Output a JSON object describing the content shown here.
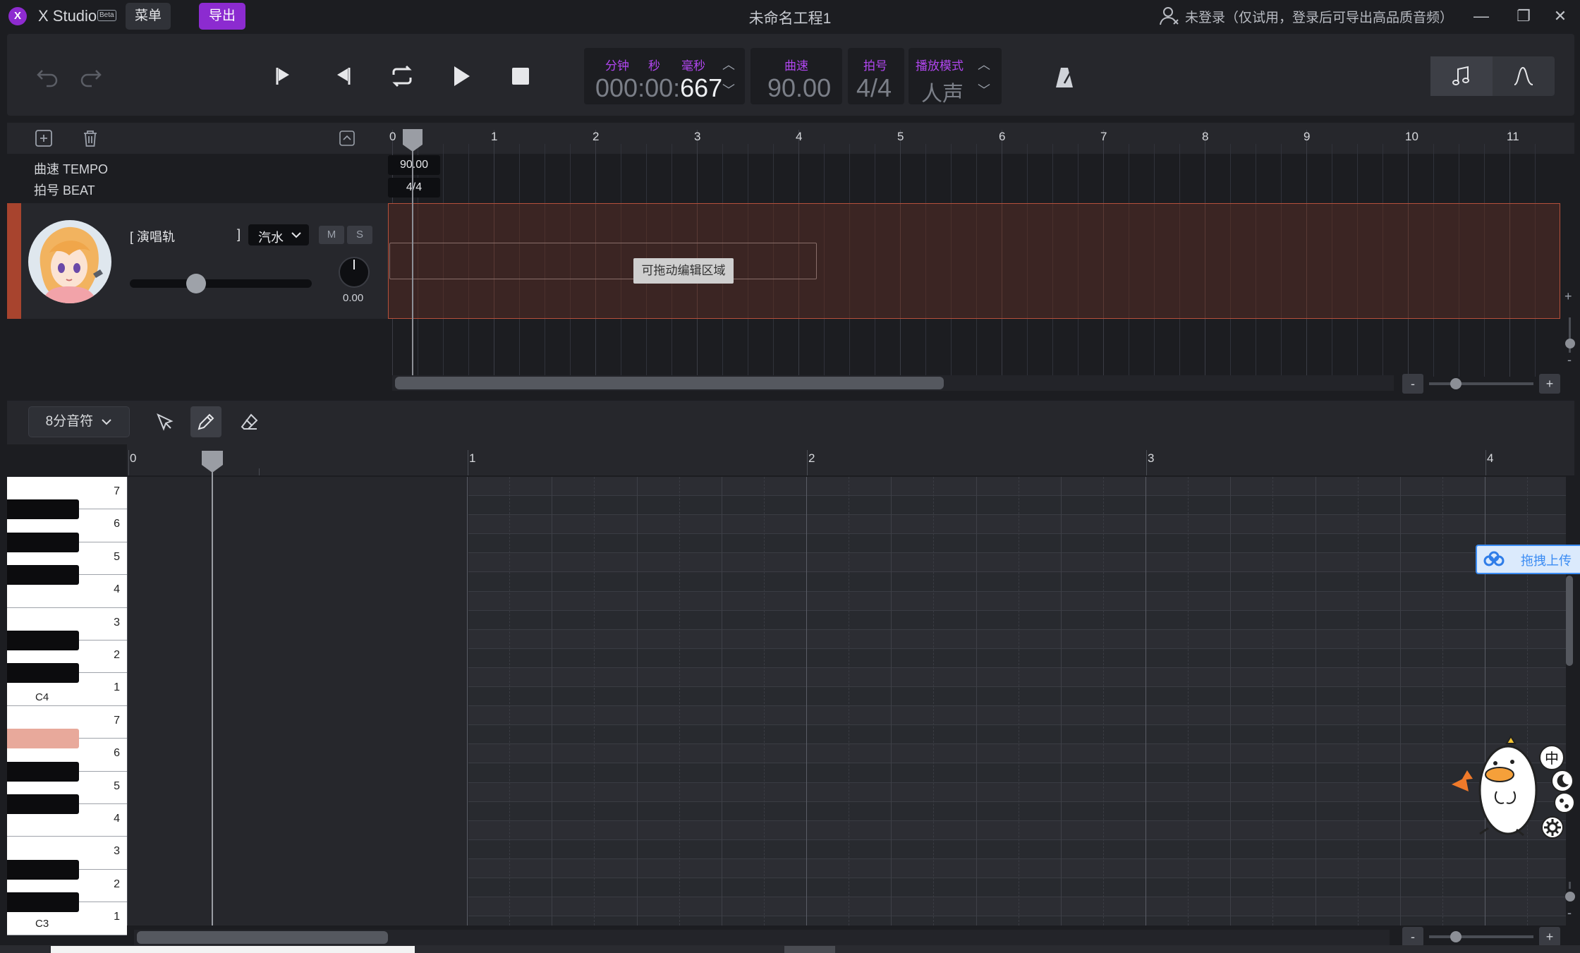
{
  "app": {
    "logo_glyph": "X",
    "name": "X Studio",
    "badge": "Beta",
    "menu_label": "菜单",
    "export_label": "导出",
    "project_title": "未命名工程1",
    "login_status": "未登录（仅试用，登录后可导出高品质音频）",
    "accent_color": "#8c2bd0"
  },
  "window_controls": {
    "minimize": "—",
    "restore": "❐",
    "close": "✕"
  },
  "transport": {
    "time": {
      "label_min": "分钟",
      "label_sec": "秒",
      "label_ms": "毫秒",
      "value_dim": "000:00:",
      "value_bright": "667"
    },
    "tempo": {
      "label": "曲速",
      "value": "90.00"
    },
    "beat": {
      "label": "拍号",
      "value": "4/4"
    },
    "play_mode": {
      "label": "播放模式",
      "value": "人声"
    }
  },
  "tracks": {
    "ruler_numbers": [
      "0",
      "1",
      "2",
      "3",
      "4",
      "5",
      "6",
      "7",
      "8",
      "9",
      "10",
      "11"
    ],
    "tempo_lane": {
      "label": "曲速 TEMPO",
      "value": "90.00"
    },
    "beat_lane": {
      "label": "拍号 BEAT",
      "value": "4/4"
    },
    "track": {
      "name_open": "[ 演唱轨",
      "name_close": "]",
      "singer": "汽水",
      "mute": "M",
      "solo": "S",
      "pan_value": "0.00",
      "color": "#a8442e"
    },
    "drag_tooltip": "可拖动编辑区域",
    "zoom_minus": "-",
    "zoom_plus": "+"
  },
  "piano_roll": {
    "quantize": "8分音符",
    "ruler_numbers": [
      "0",
      "1",
      "2",
      "3",
      "4"
    ],
    "upper_octave_labels": [
      "7",
      "6",
      "5",
      "4",
      "3",
      "2",
      "1"
    ],
    "upper_octave_name": "C4",
    "lower_octave_labels": [
      "7",
      "6",
      "5",
      "4",
      "3",
      "2",
      "1"
    ],
    "lower_octave_name": "C3",
    "zoom_minus": "-",
    "zoom_plus": "+"
  },
  "overlay": {
    "upload_label": "拖拽上传",
    "ime_label": "中"
  }
}
